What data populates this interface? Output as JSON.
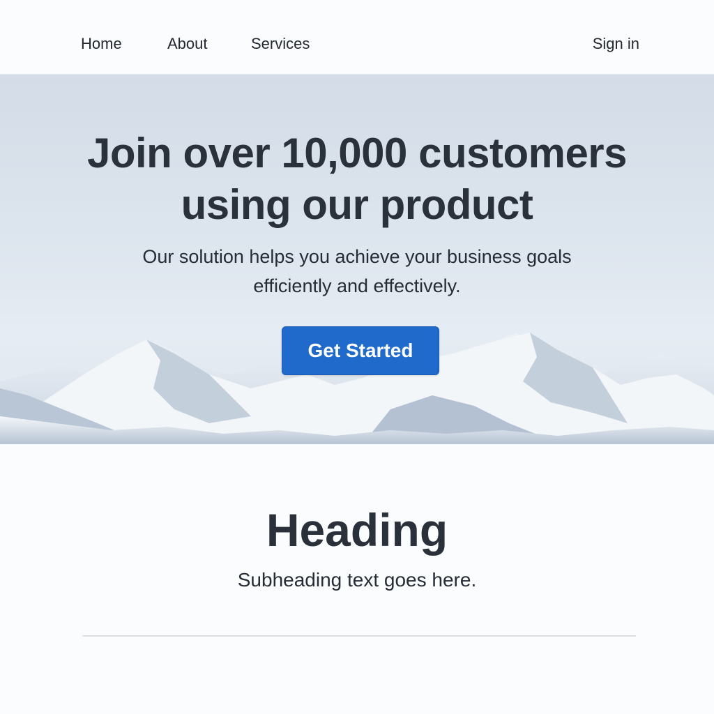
{
  "nav": {
    "links": [
      {
        "label": "Home"
      },
      {
        "label": "About"
      },
      {
        "label": "Services"
      }
    ],
    "sign_in": "Sign in"
  },
  "hero": {
    "title_line1": "Join over 10,000 customers",
    "title_line2": "using our product",
    "subtitle_line1": "Our solution helps you achieve your business goals",
    "subtitle_line2": "efficiently and effectively.",
    "cta_label": "Get Started"
  },
  "section": {
    "heading": "Heading",
    "subheading": "Subheading text goes here."
  },
  "colors": {
    "accent": "#1f6acb",
    "text": "#2b313b",
    "background": "#fbfcfe",
    "hero_bg": "#dbe3ec"
  }
}
